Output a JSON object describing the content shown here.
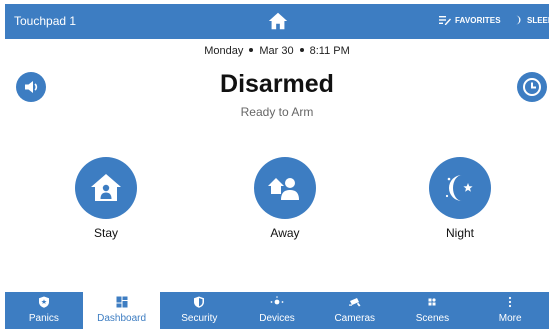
{
  "topbar": {
    "device_name": "Touchpad 1",
    "home_icon": "home-icon",
    "favorites_label": "FAVORITES",
    "sleep_label": "SLEEP"
  },
  "status": {
    "day": "Monday",
    "date": "Mar 30",
    "time": "8:11 PM",
    "state": "Disarmed",
    "substate": "Ready to Arm"
  },
  "arm_buttons": [
    {
      "label": "Stay",
      "icon": "stay-icon"
    },
    {
      "label": "Away",
      "icon": "away-icon"
    },
    {
      "label": "Night",
      "icon": "night-icon"
    }
  ],
  "nav": [
    {
      "label": "Panics",
      "icon": "shield-star-icon"
    },
    {
      "label": "Dashboard",
      "icon": "dashboard-icon",
      "active": true
    },
    {
      "label": "Security",
      "icon": "security-icon"
    },
    {
      "label": "Devices",
      "icon": "devices-icon"
    },
    {
      "label": "Cameras",
      "icon": "camera-icon"
    },
    {
      "label": "Scenes",
      "icon": "scenes-icon"
    },
    {
      "label": "More",
      "icon": "more-icon"
    }
  ],
  "colors": {
    "accent": "#3d7dc2",
    "background": "#ffffff",
    "text": "#111111",
    "subtext": "#666666"
  }
}
